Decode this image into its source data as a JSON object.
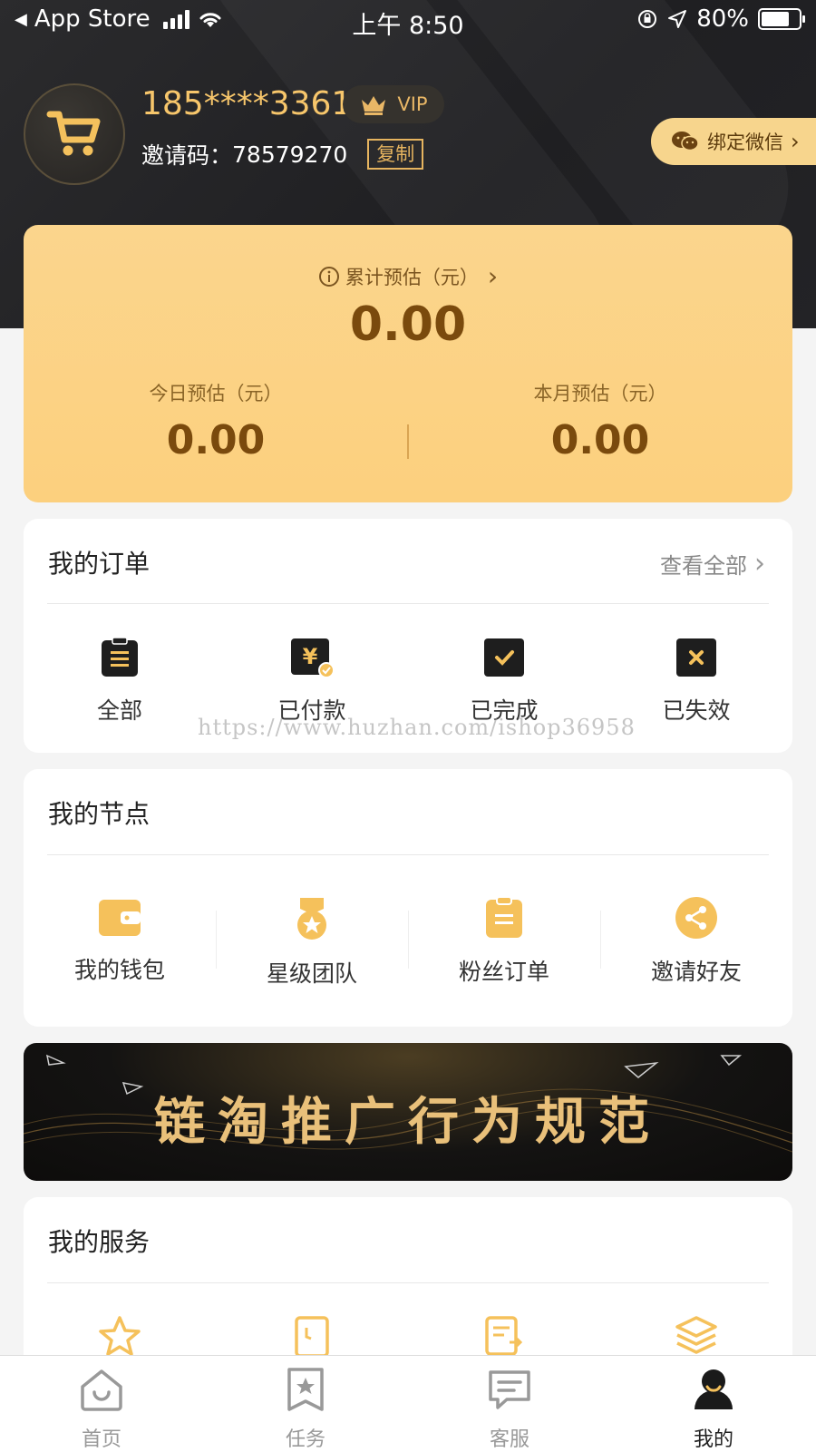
{
  "status_bar": {
    "back_label": "App Store",
    "time": "上午 8:50",
    "battery": "80%"
  },
  "profile": {
    "phone": "185****3361",
    "vip_label": "VIP",
    "invite_prefix": "邀请码：",
    "invite_code": "78579270",
    "copy_label": "复制",
    "bind_wechat_label": "绑定微信"
  },
  "earnings": {
    "total_label": "累计预估（元）",
    "total_value": "0.00",
    "today_label": "今日预估（元）",
    "today_value": "0.00",
    "month_label": "本月预估（元）",
    "month_value": "0.00"
  },
  "orders": {
    "title": "我的订单",
    "view_all": "查看全部",
    "items": [
      {
        "label": "全部",
        "icon": "clipboard-icon"
      },
      {
        "label": "已付款",
        "icon": "paid-icon"
      },
      {
        "label": "已完成",
        "icon": "check-icon"
      },
      {
        "label": "已失效",
        "icon": "invalid-icon"
      }
    ]
  },
  "watermark": "https://www.huzhan.com/ishop36958",
  "nodes": {
    "title": "我的节点",
    "items": [
      {
        "label": "我的钱包",
        "icon": "wallet-icon"
      },
      {
        "label": "星级团队",
        "icon": "medal-icon"
      },
      {
        "label": "粉丝订单",
        "icon": "fans-order-icon"
      },
      {
        "label": "邀请好友",
        "icon": "share-icon"
      }
    ]
  },
  "banner": {
    "text": "链淘推广行为规范"
  },
  "services": {
    "title": "我的服务",
    "items": [
      {
        "icon": "star-icon"
      },
      {
        "icon": "bookmark-icon"
      },
      {
        "icon": "exchange-icon"
      },
      {
        "icon": "layers-icon"
      }
    ]
  },
  "tabbar": {
    "items": [
      {
        "label": "首页",
        "icon": "home-icon"
      },
      {
        "label": "任务",
        "icon": "task-icon"
      },
      {
        "label": "客服",
        "icon": "chat-icon"
      },
      {
        "label": "我的",
        "icon": "user-icon"
      }
    ],
    "active_index": 3
  },
  "colors": {
    "accent": "#f5c15b",
    "dark_header": "#222224",
    "earn_card": "#fcd385",
    "earn_text": "#7a4a0d"
  }
}
